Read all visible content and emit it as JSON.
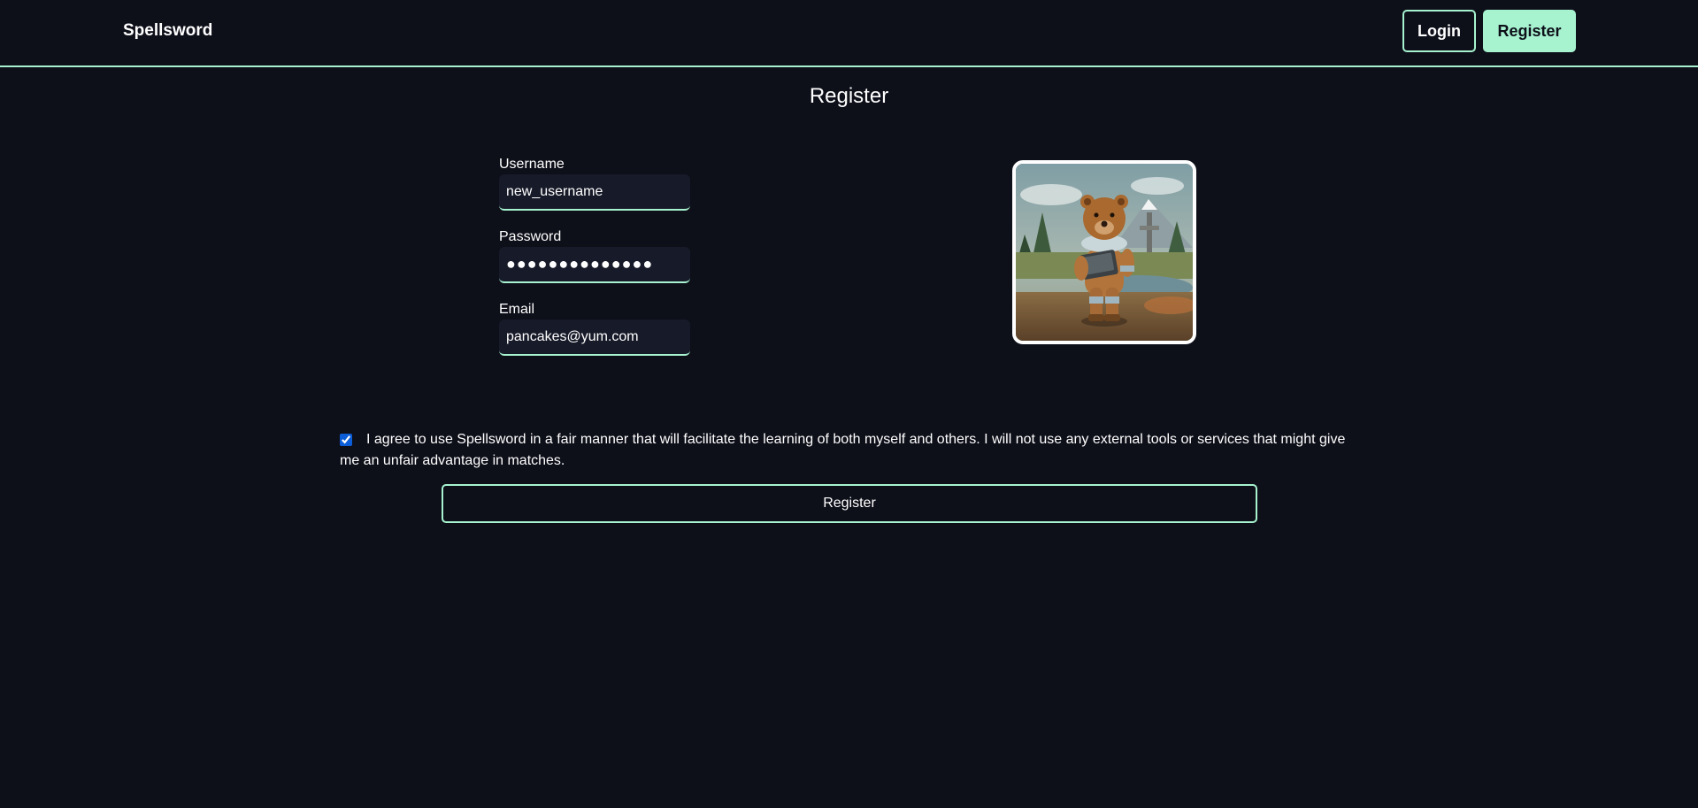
{
  "nav": {
    "brand": "Spellsword",
    "login_label": "Login",
    "register_label": "Register"
  },
  "page": {
    "title": "Register"
  },
  "form": {
    "username": {
      "label": "Username",
      "value": "new_username"
    },
    "password": {
      "label": "Password",
      "value": "●●●●●●●●●●●●●●"
    },
    "email": {
      "label": "Email",
      "value": "pancakes@yum.com"
    },
    "agreement": {
      "checked": true,
      "text": "I agree to use Spellsword in a fair manner that will facilitate the learning of both myself and others. I will not use any external tools or services that might give me an unfair advantage in matches."
    },
    "submit_label": "Register"
  },
  "avatar": {
    "icon": "bear-astronaut-illustration"
  },
  "colors": {
    "background": "#0d0f19",
    "accent": "#a7f3d0",
    "input_bg": "#171a28",
    "checkbox": "#0b5ed7"
  }
}
